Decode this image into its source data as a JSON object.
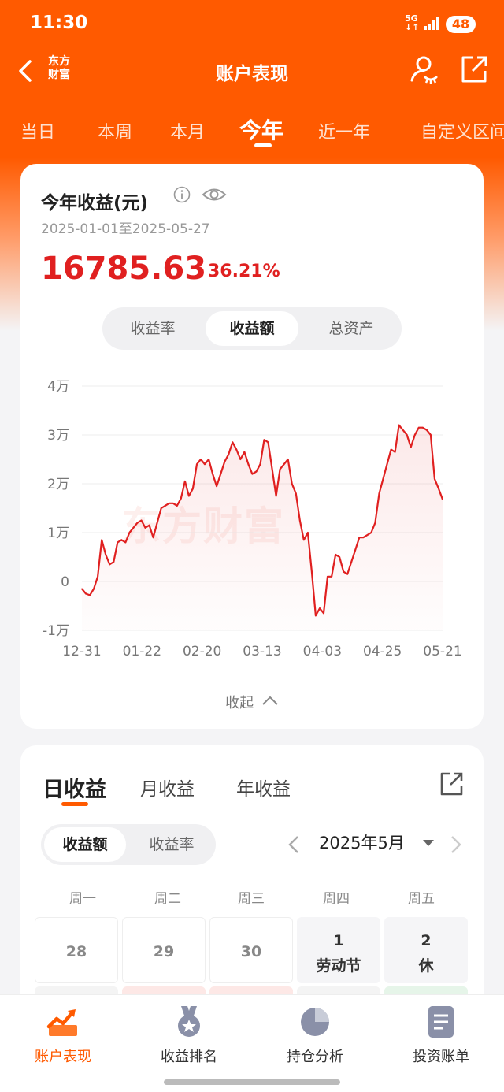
{
  "status": {
    "time": "11:30",
    "network": "5G",
    "battery": "48"
  },
  "header": {
    "logo_line1": "东方",
    "logo_line2": "财富",
    "title": "账户表现"
  },
  "tabs": [
    {
      "label": "当日"
    },
    {
      "label": "本周"
    },
    {
      "label": "本月"
    },
    {
      "label": "今年"
    },
    {
      "label": "近一年"
    },
    {
      "label": "自定义区间"
    }
  ],
  "active_tab_index": 3,
  "summary": {
    "title": "今年收益(元)",
    "date_range": "2025-01-01至2025-05-27",
    "amount": "16785.63",
    "percent": "36.21%",
    "accent_color": "#e02020"
  },
  "metric_segments": [
    {
      "label": "收益率"
    },
    {
      "label": "收益额"
    },
    {
      "label": "总资产"
    }
  ],
  "active_metric_index": 1,
  "watermark": "东方财富",
  "collapse_label": "收起",
  "chart_data": {
    "type": "area",
    "ylabel": "",
    "xlabel": "",
    "yticks": [
      "4万",
      "3万",
      "2万",
      "1万",
      "0",
      "-1万"
    ],
    "ytick_values": [
      40000,
      30000,
      20000,
      10000,
      0,
      -10000
    ],
    "ylim": [
      -10000,
      40000
    ],
    "xticks": [
      "12-31",
      "01-22",
      "02-20",
      "03-13",
      "04-03",
      "04-25",
      "05-21"
    ],
    "grid": true,
    "color": "#e02020",
    "series": [
      {
        "values": [
          -1500,
          -2500,
          -2800,
          -1500,
          1000,
          8500,
          5500,
          3500,
          4000,
          8000,
          8500,
          8000,
          10000,
          11000,
          12000,
          12500,
          11000,
          11500,
          9000,
          12000,
          15000,
          15500,
          16000,
          16000,
          15500,
          17000,
          20500,
          17500,
          19000,
          24000,
          25000,
          24000,
          25000,
          22000,
          19500,
          22000,
          24500,
          26000,
          28500,
          27000,
          25000,
          26500,
          24000,
          22000,
          22500,
          24000,
          29000,
          28500,
          23000,
          17500,
          23000,
          24000,
          25000,
          20000,
          18000,
          12500,
          8500,
          10000,
          2000,
          -7000,
          -5500,
          -6500,
          1000,
          1000,
          5500,
          5000,
          2000,
          1500,
          4000,
          6500,
          9000,
          9000,
          9500,
          10000,
          12000,
          18000,
          21000,
          24000,
          27000,
          26500,
          32000,
          31000,
          30000,
          27500,
          30000,
          31500,
          31500,
          31000,
          30000,
          21000,
          19000,
          16785
        ]
      }
    ]
  },
  "calendar": {
    "tabs": [
      {
        "label": "日收益"
      },
      {
        "label": "月收益"
      },
      {
        "label": "年收益"
      }
    ],
    "active_tab_index": 0,
    "segments": [
      {
        "label": "收益额"
      },
      {
        "label": "收益率"
      }
    ],
    "active_segment_index": 0,
    "month": "2025年5月",
    "weekdays": [
      "周一",
      "周二",
      "周三",
      "周四",
      "周五"
    ],
    "days": [
      {
        "num": "28",
        "note": ""
      },
      {
        "num": "29",
        "note": ""
      },
      {
        "num": "30",
        "note": ""
      },
      {
        "num": "1",
        "note": "劳动节"
      },
      {
        "num": "2",
        "note": "休"
      }
    ],
    "next_row_colors": [
      "#f4f4f4",
      "#fde8e6",
      "#fde8e6",
      "#f4f4f4",
      "#e6f5e9"
    ]
  },
  "bottom_nav": [
    {
      "label": "账户表现"
    },
    {
      "label": "收益排名"
    },
    {
      "label": "持仓分析"
    },
    {
      "label": "投资账单"
    }
  ],
  "active_nav_index": 0
}
